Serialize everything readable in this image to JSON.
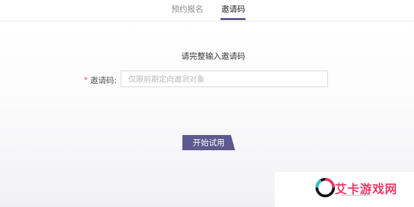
{
  "tabs": [
    {
      "label": "预约报名",
      "active": false
    },
    {
      "label": "邀请码",
      "active": true
    }
  ],
  "form": {
    "title": "请完整输入邀请码",
    "required_mark": "*",
    "field_label": "邀请码:",
    "input_placeholder": "仅限前期定向邀测对象",
    "input_value": ""
  },
  "start_button": {
    "label": "开始试用"
  },
  "watermark": {
    "text": "艾卡游戏网"
  },
  "colors": {
    "accent": "#5e5a8f",
    "required": "#e04848",
    "watermark": "#e93c66"
  }
}
